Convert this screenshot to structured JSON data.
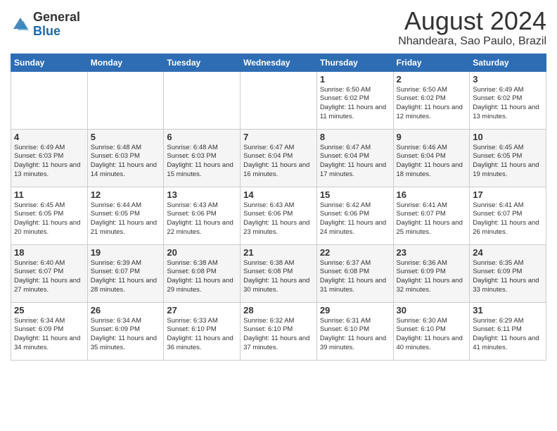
{
  "header": {
    "logo_general": "General",
    "logo_blue": "Blue",
    "month_year": "August 2024",
    "location": "Nhandeara, Sao Paulo, Brazil"
  },
  "days_of_week": [
    "Sunday",
    "Monday",
    "Tuesday",
    "Wednesday",
    "Thursday",
    "Friday",
    "Saturday"
  ],
  "weeks": [
    [
      {
        "day": "",
        "info": ""
      },
      {
        "day": "",
        "info": ""
      },
      {
        "day": "",
        "info": ""
      },
      {
        "day": "",
        "info": ""
      },
      {
        "day": "1",
        "info": "Sunrise: 6:50 AM\nSunset: 6:02 PM\nDaylight: 11 hours\nand 11 minutes."
      },
      {
        "day": "2",
        "info": "Sunrise: 6:50 AM\nSunset: 6:02 PM\nDaylight: 11 hours\nand 12 minutes."
      },
      {
        "day": "3",
        "info": "Sunrise: 6:49 AM\nSunset: 6:02 PM\nDaylight: 11 hours\nand 13 minutes."
      }
    ],
    [
      {
        "day": "4",
        "info": "Sunrise: 6:49 AM\nSunset: 6:03 PM\nDaylight: 11 hours\nand 13 minutes."
      },
      {
        "day": "5",
        "info": "Sunrise: 6:48 AM\nSunset: 6:03 PM\nDaylight: 11 hours\nand 14 minutes."
      },
      {
        "day": "6",
        "info": "Sunrise: 6:48 AM\nSunset: 6:03 PM\nDaylight: 11 hours\nand 15 minutes."
      },
      {
        "day": "7",
        "info": "Sunrise: 6:47 AM\nSunset: 6:04 PM\nDaylight: 11 hours\nand 16 minutes."
      },
      {
        "day": "8",
        "info": "Sunrise: 6:47 AM\nSunset: 6:04 PM\nDaylight: 11 hours\nand 17 minutes."
      },
      {
        "day": "9",
        "info": "Sunrise: 6:46 AM\nSunset: 6:04 PM\nDaylight: 11 hours\nand 18 minutes."
      },
      {
        "day": "10",
        "info": "Sunrise: 6:45 AM\nSunset: 6:05 PM\nDaylight: 11 hours\nand 19 minutes."
      }
    ],
    [
      {
        "day": "11",
        "info": "Sunrise: 6:45 AM\nSunset: 6:05 PM\nDaylight: 11 hours\nand 20 minutes."
      },
      {
        "day": "12",
        "info": "Sunrise: 6:44 AM\nSunset: 6:05 PM\nDaylight: 11 hours\nand 21 minutes."
      },
      {
        "day": "13",
        "info": "Sunrise: 6:43 AM\nSunset: 6:06 PM\nDaylight: 11 hours\nand 22 minutes."
      },
      {
        "day": "14",
        "info": "Sunrise: 6:43 AM\nSunset: 6:06 PM\nDaylight: 11 hours\nand 23 minutes."
      },
      {
        "day": "15",
        "info": "Sunrise: 6:42 AM\nSunset: 6:06 PM\nDaylight: 11 hours\nand 24 minutes."
      },
      {
        "day": "16",
        "info": "Sunrise: 6:41 AM\nSunset: 6:07 PM\nDaylight: 11 hours\nand 25 minutes."
      },
      {
        "day": "17",
        "info": "Sunrise: 6:41 AM\nSunset: 6:07 PM\nDaylight: 11 hours\nand 26 minutes."
      }
    ],
    [
      {
        "day": "18",
        "info": "Sunrise: 6:40 AM\nSunset: 6:07 PM\nDaylight: 11 hours\nand 27 minutes."
      },
      {
        "day": "19",
        "info": "Sunrise: 6:39 AM\nSunset: 6:07 PM\nDaylight: 11 hours\nand 28 minutes."
      },
      {
        "day": "20",
        "info": "Sunrise: 6:38 AM\nSunset: 6:08 PM\nDaylight: 11 hours\nand 29 minutes."
      },
      {
        "day": "21",
        "info": "Sunrise: 6:38 AM\nSunset: 6:08 PM\nDaylight: 11 hours\nand 30 minutes."
      },
      {
        "day": "22",
        "info": "Sunrise: 6:37 AM\nSunset: 6:08 PM\nDaylight: 11 hours\nand 31 minutes."
      },
      {
        "day": "23",
        "info": "Sunrise: 6:36 AM\nSunset: 6:09 PM\nDaylight: 11 hours\nand 32 minutes."
      },
      {
        "day": "24",
        "info": "Sunrise: 6:35 AM\nSunset: 6:09 PM\nDaylight: 11 hours\nand 33 minutes."
      }
    ],
    [
      {
        "day": "25",
        "info": "Sunrise: 6:34 AM\nSunset: 6:09 PM\nDaylight: 11 hours\nand 34 minutes."
      },
      {
        "day": "26",
        "info": "Sunrise: 6:34 AM\nSunset: 6:09 PM\nDaylight: 11 hours\nand 35 minutes."
      },
      {
        "day": "27",
        "info": "Sunrise: 6:33 AM\nSunset: 6:10 PM\nDaylight: 11 hours\nand 36 minutes."
      },
      {
        "day": "28",
        "info": "Sunrise: 6:32 AM\nSunset: 6:10 PM\nDaylight: 11 hours\nand 37 minutes."
      },
      {
        "day": "29",
        "info": "Sunrise: 6:31 AM\nSunset: 6:10 PM\nDaylight: 11 hours\nand 39 minutes."
      },
      {
        "day": "30",
        "info": "Sunrise: 6:30 AM\nSunset: 6:10 PM\nDaylight: 11 hours\nand 40 minutes."
      },
      {
        "day": "31",
        "info": "Sunrise: 6:29 AM\nSunset: 6:11 PM\nDaylight: 11 hours\nand 41 minutes."
      }
    ]
  ]
}
